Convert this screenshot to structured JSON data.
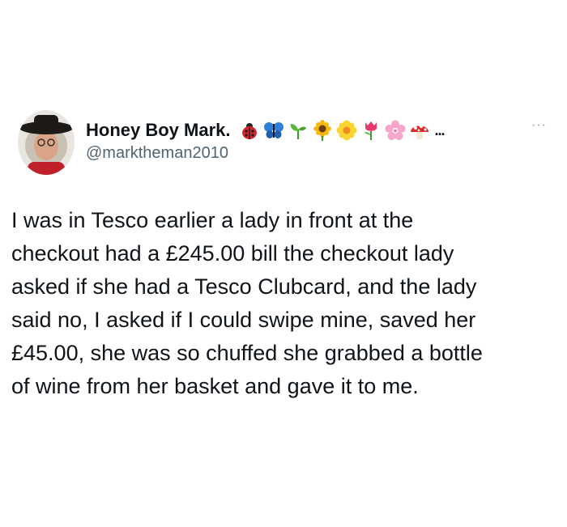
{
  "tweet": {
    "display_name": "Honey Boy Mark.",
    "name_emojis": [
      "ladybug-icon",
      "butterfly-icon",
      "seedling-icon",
      "sunflower-icon",
      "blossom-icon",
      "tulip-icon",
      "cherry-blossom-icon",
      "mushroom-icon"
    ],
    "name_truncation": "...",
    "handle": "@marktheman2010",
    "more_menu": "···",
    "body_lines": [
      "I was in Tesco earlier a lady in front at the",
      "checkout had a £245.00 bill the checkout lady",
      "asked if she had a Tesco Clubcard, and the lady",
      "said no, I asked if I could swipe mine, saved her",
      "£45.00, she was so chuffed she grabbed a bottle",
      "of wine from her basket and gave it to me."
    ]
  },
  "colors": {
    "text_primary": "#0f1419",
    "text_secondary": "#536471",
    "background": "#ffffff"
  }
}
